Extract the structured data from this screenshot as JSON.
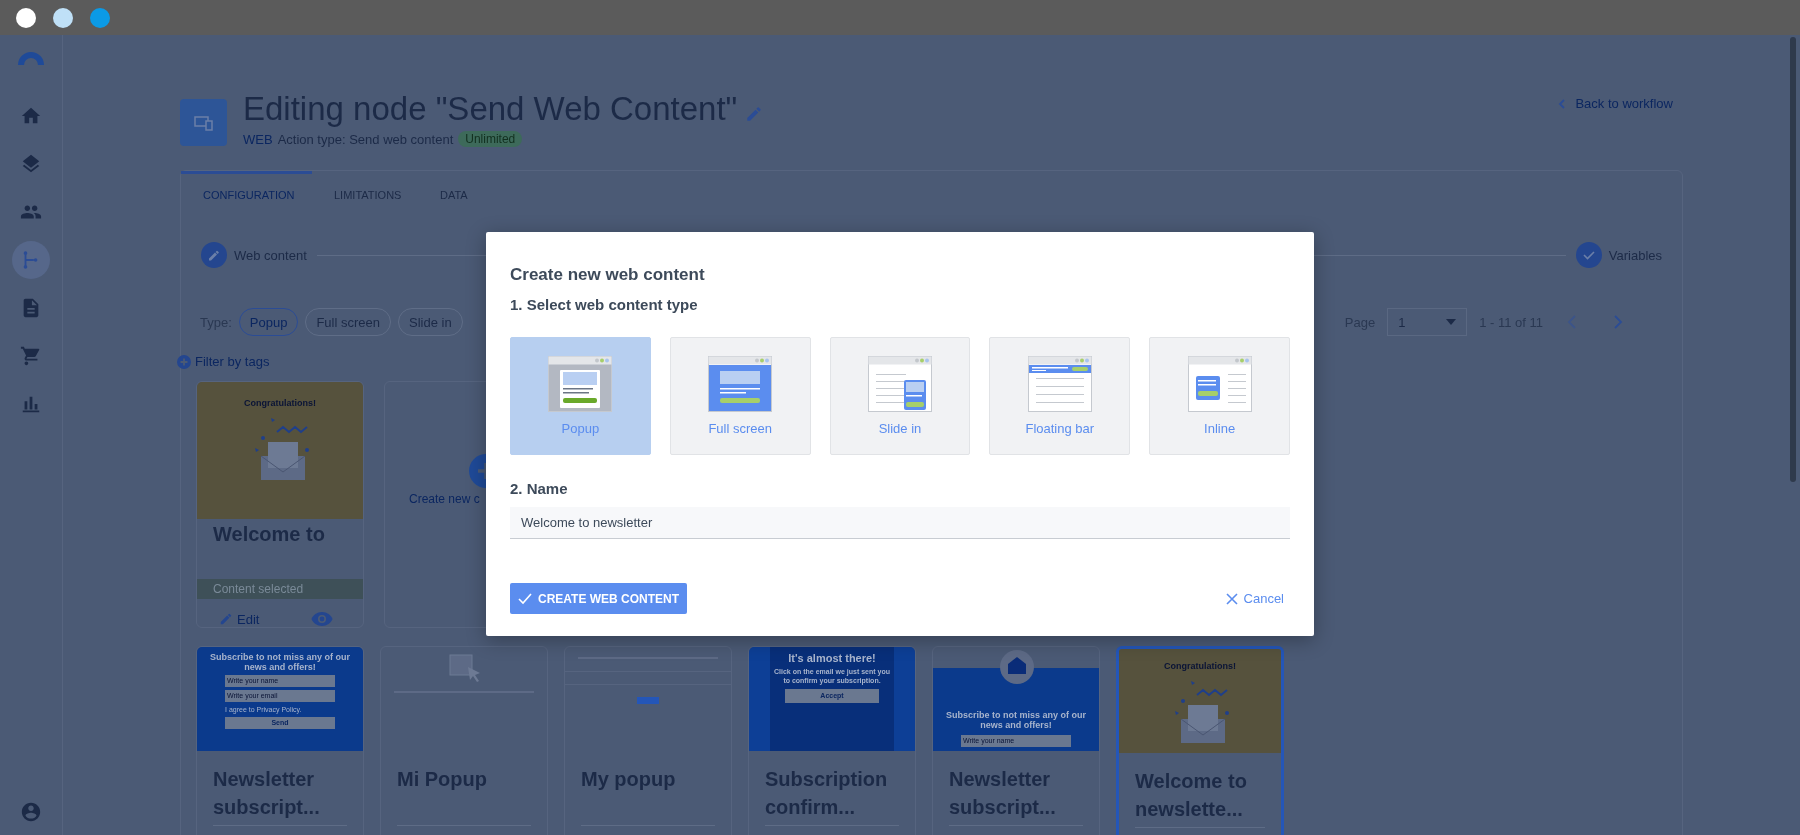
{
  "sidebar": {
    "items": [
      {
        "selected": false
      },
      {
        "selected": false
      },
      {
        "selected": false
      },
      {
        "selected": true
      },
      {
        "selected": false
      },
      {
        "selected": false
      },
      {
        "selected": false
      }
    ]
  },
  "header": {
    "title": "Editing node \"Send Web Content\"",
    "channel": "WEB",
    "action_type": "Action type: Send web content",
    "badge": "Unlimited",
    "back_link": "Back to workflow"
  },
  "tabs": [
    {
      "label": "CONFIGURATION",
      "selected": true
    },
    {
      "label": "LIMITATIONS",
      "selected": false
    },
    {
      "label": "DATA",
      "selected": false
    }
  ],
  "stepper": [
    {
      "label": "Web content",
      "kind": "edit"
    },
    {
      "label": "Variables",
      "kind": "done"
    }
  ],
  "filters": {
    "type_label": "Type:",
    "chips": [
      {
        "label": "Popup",
        "selected": true
      },
      {
        "label": "Full screen",
        "selected": false
      },
      {
        "label": "Slide in",
        "selected": false
      }
    ],
    "filter_by_tags": "Filter by tags"
  },
  "pagination": {
    "label": "Page",
    "value": "1",
    "range": "1 - 11 of 11"
  },
  "selected_card": {
    "preview": {
      "kind": "congrats",
      "heading": "Congratulations!"
    },
    "title": "Welcome to",
    "status": "Content selected",
    "edit": "Edit"
  },
  "create_card": {
    "label": "Create new c"
  },
  "cards": [
    {
      "preview": {
        "kind": "form",
        "heading": "Subscribe to not miss any of our news and offers!",
        "fields": [
          "Write your name",
          "Write your email"
        ],
        "checkbox": "I agree to Privacy Policy.",
        "button": "Send"
      },
      "title": "Newsletter subscript...",
      "selected": false
    },
    {
      "preview": {
        "kind": "blank"
      },
      "title": "Mi Popup",
      "selected": false
    },
    {
      "preview": {
        "kind": "lines"
      },
      "title": "My popup",
      "selected": false
    },
    {
      "preview": {
        "kind": "confirm",
        "heading": "It's almost there!",
        "text": "Click on the email we just sent you to confirm your subscription.",
        "button": "Accept"
      },
      "title": "Subscription confirm...",
      "selected": false
    },
    {
      "preview": {
        "kind": "banner",
        "heading": "Subscribe to not miss any of our news and offers!",
        "fields": [
          "Write your name"
        ]
      },
      "title": "Newsletter subscript...",
      "selected": false
    },
    {
      "preview": {
        "kind": "congrats",
        "heading": "Congratulations!"
      },
      "title": "Welcome to newslette...",
      "selected": true
    }
  ],
  "modal": {
    "title": "Create new web content",
    "step1": "1. Select web content type",
    "types": [
      {
        "kind": "popup",
        "label": "Popup",
        "selected": true
      },
      {
        "kind": "fullscreen",
        "label": "Full screen",
        "selected": false
      },
      {
        "kind": "slidein",
        "label": "Slide in",
        "selected": false
      },
      {
        "kind": "floatingbar",
        "label": "Floating bar",
        "selected": false
      },
      {
        "kind": "inline",
        "label": "Inline",
        "selected": false
      }
    ],
    "step2": "2. Name",
    "name_value": "Welcome to newsletter",
    "create_button": "CREATE WEB CONTENT",
    "cancel_button": "Cancel"
  }
}
